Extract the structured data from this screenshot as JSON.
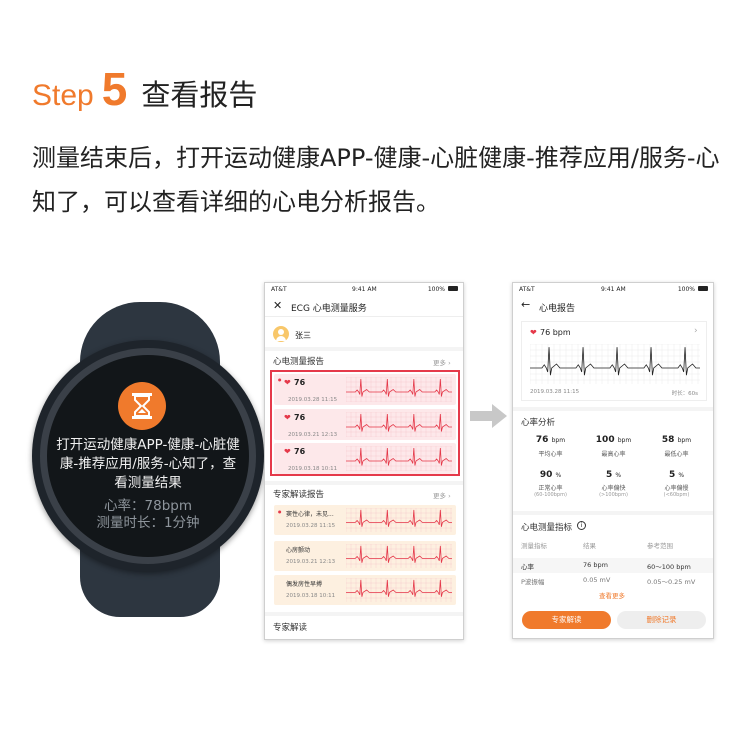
{
  "header": {
    "step_word": "Step",
    "step_number": "5",
    "step_label": "查看报告",
    "description": "测量结束后，打开运动健康APP-健康-心脏健康-推荐应用/服务-心知了，可以查看详细的心电分析报告。"
  },
  "watch": {
    "icon": "hourglass-icon",
    "message": "打开运动健康APP-健康-心脏健康-推荐应用/服务-心知了，查看测量结果",
    "rate": "心率：78bpm",
    "duration": "测量时长：1分钟",
    "accent": "#f07a2c"
  },
  "phone1": {
    "status": {
      "carrier": "AT&T",
      "time": "9:41 AM",
      "battery": "100%"
    },
    "title": "ECG 心电测量服务",
    "user": "张三",
    "reports_title": "心电测量报告",
    "more_label": "更多",
    "reports": [
      {
        "value": "76",
        "date": "2019.03.28 11:15"
      },
      {
        "value": "76",
        "date": "2019.03.21 12:13"
      },
      {
        "value": "76",
        "date": "2019.03.18 10:11"
      }
    ],
    "expert_title": "专家解读报告",
    "expert_reports": [
      {
        "label": "窦性心律，未见...",
        "date": "2019.03.28 11:15"
      },
      {
        "label": "心房颤动",
        "date": "2019.03.21 12:13"
      },
      {
        "label": "偶发房性早搏",
        "date": "2019.03.18 10:11"
      }
    ],
    "bottom_title": "专家解读"
  },
  "phone2": {
    "status": {
      "carrier": "AT&T",
      "time": "9:41 AM",
      "battery": "100%"
    },
    "title": "心电报告",
    "bpm": "76 bpm",
    "date": "2019.03.28 11:15",
    "duration": "时长：60s",
    "analysis_title": "心率分析",
    "stats_row1": [
      {
        "value": "76",
        "unit": "bpm",
        "label": "平均心率"
      },
      {
        "value": "100",
        "unit": "bpm",
        "label": "最高心率"
      },
      {
        "value": "58",
        "unit": "bpm",
        "label": "最低心率"
      }
    ],
    "stats_row2": [
      {
        "value": "90",
        "unit": "%",
        "label": "正常心率",
        "range": "(60-100bpm)"
      },
      {
        "value": "5",
        "unit": "%",
        "label": "心率偏快",
        "range": "(>100bpm)"
      },
      {
        "value": "5",
        "unit": "%",
        "label": "心率偏慢",
        "range": "(<60bpm)"
      }
    ],
    "metrics_title": "心电测量指标",
    "table_headers": [
      "测量指标",
      "结果",
      "参考范围"
    ],
    "table_rows": [
      [
        "心率",
        "76 bpm",
        "60～100 bpm"
      ],
      [
        "P波振幅",
        "0.05 mV",
        "0.05～0.25 mV"
      ]
    ],
    "see_more": "查看更多",
    "expert_button": "专家解读",
    "delete_button": "删除记录"
  },
  "colors": {
    "accent": "#f07a2c",
    "highlight": "#e5394a",
    "card_pink": "#fde8ea",
    "card_peach": "#fdf0e0"
  }
}
